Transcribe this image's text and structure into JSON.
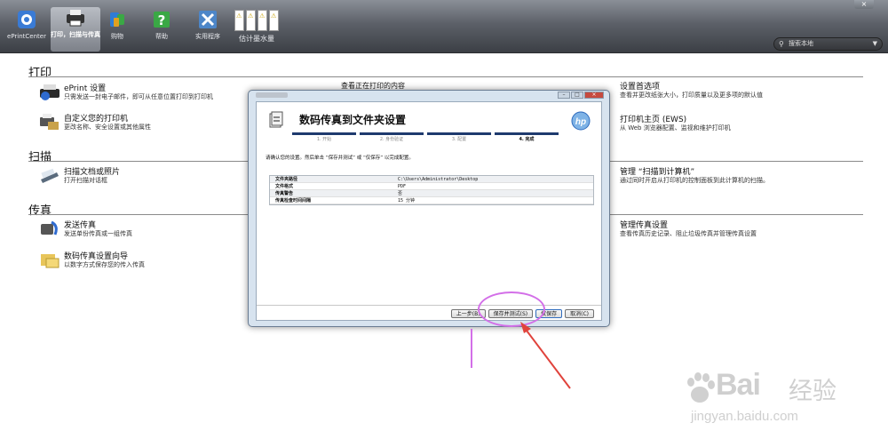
{
  "toolbar": {
    "buttons": [
      {
        "id": "eprintcenter",
        "label": "ePrintCenter"
      },
      {
        "id": "print-scan-fax",
        "label": "打印，扫描与传真"
      },
      {
        "id": "shop",
        "label": "购物"
      },
      {
        "id": "help",
        "label": "帮助"
      },
      {
        "id": "tools",
        "label": "实用程序"
      }
    ],
    "ink_label": "估计墨水量",
    "search_placeholder": "搜索本地",
    "close_glyph": "×"
  },
  "sections": {
    "print": {
      "title": "打印",
      "items": [
        {
          "title": "ePrint 设置",
          "desc": "只需发送一封电子邮件，即可从任意位置打印到打印机"
        },
        {
          "title": "自定义您的打印机",
          "desc": "更改名称、安全设置或其他属性"
        }
      ],
      "mid_item": "查看正在打印的内容",
      "right_items": [
        {
          "title": "设置首选项",
          "desc": "查看并更改纸张大小，打印质量以及更多项的默认值"
        },
        {
          "title": "打印机主页 (EWS)",
          "desc": "从 Web 浏览器配置、监视和维护打印机"
        }
      ]
    },
    "scan": {
      "title": "扫描",
      "items": [
        {
          "title": "扫描文档或照片",
          "desc": "打开扫描对话框"
        }
      ],
      "right_items": [
        {
          "title": "管理 “扫描到计算机”",
          "desc": "通过同时开启从打印机的控制面板到此计算机的扫描。"
        }
      ]
    },
    "fax": {
      "title": "传真",
      "items": [
        {
          "title": "发送传真",
          "desc": "发送单份传真或一组传真"
        },
        {
          "title": "数码传真设置向导",
          "desc": "以数字方式保存您的传入传真"
        }
      ],
      "right_items": [
        {
          "title": "管理传真设置",
          "desc": "查看传真历史记录、阻止垃圾传真并管理传真设置"
        }
      ]
    }
  },
  "dialog": {
    "title": "数码传真到文件夹设置",
    "steps": [
      {
        "label": "1. 开始"
      },
      {
        "label": "2. 身份验证"
      },
      {
        "label": "3. 配置"
      },
      {
        "label": "4. 完成"
      }
    ],
    "note": "请确认您的设置。然后单击 “保存并测试” 或 “仅保存” 以完成配置。",
    "summary": [
      {
        "key": "文件夹路径",
        "value": "C:\\Users\\Administrator\\Desktop"
      },
      {
        "key": "文件格式",
        "value": "PDF"
      },
      {
        "key": "传真警告",
        "value": "否"
      },
      {
        "key": "传真检查时间间隔",
        "value": "15 分钟"
      }
    ],
    "buttons": {
      "back": "上一步(B)",
      "save_test": "保存并测试(S)",
      "save_only": "仅保存",
      "cancel": "取消(C)"
    }
  },
  "watermark": {
    "brand": "Bai",
    "brand_cn": "经验",
    "url": "jingyan.baidu.com"
  },
  "colors": {
    "toolbar": "#5c6068",
    "dialog_frame": "#d7e3ef",
    "step_bar": "#1f3a6e",
    "annotation": "#d36fe8",
    "arrow": "#e0433c"
  }
}
